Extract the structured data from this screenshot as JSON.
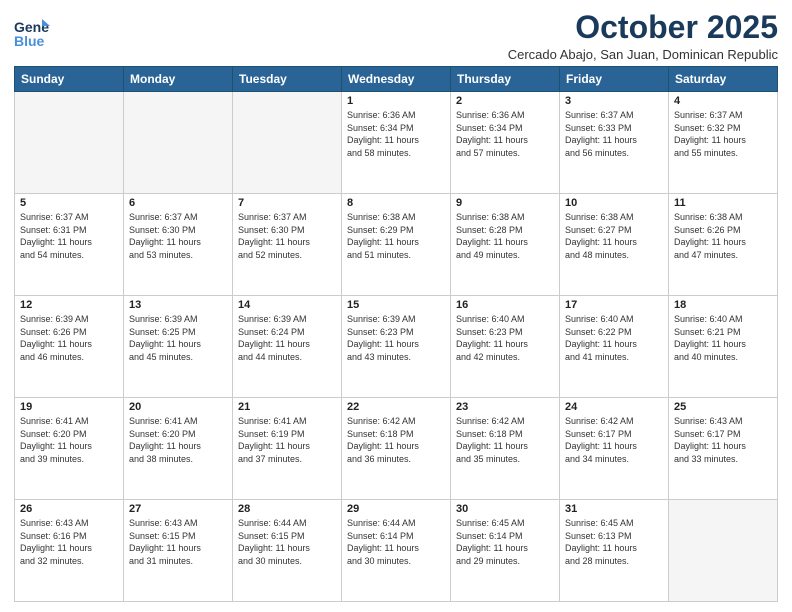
{
  "header": {
    "logo_line1": "General",
    "logo_line2": "Blue",
    "month": "October 2025",
    "location": "Cercado Abajo, San Juan, Dominican Republic"
  },
  "days_of_week": [
    "Sunday",
    "Monday",
    "Tuesday",
    "Wednesday",
    "Thursday",
    "Friday",
    "Saturday"
  ],
  "weeks": [
    [
      {
        "day": "",
        "info": ""
      },
      {
        "day": "",
        "info": ""
      },
      {
        "day": "",
        "info": ""
      },
      {
        "day": "1",
        "info": "Sunrise: 6:36 AM\nSunset: 6:34 PM\nDaylight: 11 hours\nand 58 minutes."
      },
      {
        "day": "2",
        "info": "Sunrise: 6:36 AM\nSunset: 6:34 PM\nDaylight: 11 hours\nand 57 minutes."
      },
      {
        "day": "3",
        "info": "Sunrise: 6:37 AM\nSunset: 6:33 PM\nDaylight: 11 hours\nand 56 minutes."
      },
      {
        "day": "4",
        "info": "Sunrise: 6:37 AM\nSunset: 6:32 PM\nDaylight: 11 hours\nand 55 minutes."
      }
    ],
    [
      {
        "day": "5",
        "info": "Sunrise: 6:37 AM\nSunset: 6:31 PM\nDaylight: 11 hours\nand 54 minutes."
      },
      {
        "day": "6",
        "info": "Sunrise: 6:37 AM\nSunset: 6:30 PM\nDaylight: 11 hours\nand 53 minutes."
      },
      {
        "day": "7",
        "info": "Sunrise: 6:37 AM\nSunset: 6:30 PM\nDaylight: 11 hours\nand 52 minutes."
      },
      {
        "day": "8",
        "info": "Sunrise: 6:38 AM\nSunset: 6:29 PM\nDaylight: 11 hours\nand 51 minutes."
      },
      {
        "day": "9",
        "info": "Sunrise: 6:38 AM\nSunset: 6:28 PM\nDaylight: 11 hours\nand 49 minutes."
      },
      {
        "day": "10",
        "info": "Sunrise: 6:38 AM\nSunset: 6:27 PM\nDaylight: 11 hours\nand 48 minutes."
      },
      {
        "day": "11",
        "info": "Sunrise: 6:38 AM\nSunset: 6:26 PM\nDaylight: 11 hours\nand 47 minutes."
      }
    ],
    [
      {
        "day": "12",
        "info": "Sunrise: 6:39 AM\nSunset: 6:26 PM\nDaylight: 11 hours\nand 46 minutes."
      },
      {
        "day": "13",
        "info": "Sunrise: 6:39 AM\nSunset: 6:25 PM\nDaylight: 11 hours\nand 45 minutes."
      },
      {
        "day": "14",
        "info": "Sunrise: 6:39 AM\nSunset: 6:24 PM\nDaylight: 11 hours\nand 44 minutes."
      },
      {
        "day": "15",
        "info": "Sunrise: 6:39 AM\nSunset: 6:23 PM\nDaylight: 11 hours\nand 43 minutes."
      },
      {
        "day": "16",
        "info": "Sunrise: 6:40 AM\nSunset: 6:23 PM\nDaylight: 11 hours\nand 42 minutes."
      },
      {
        "day": "17",
        "info": "Sunrise: 6:40 AM\nSunset: 6:22 PM\nDaylight: 11 hours\nand 41 minutes."
      },
      {
        "day": "18",
        "info": "Sunrise: 6:40 AM\nSunset: 6:21 PM\nDaylight: 11 hours\nand 40 minutes."
      }
    ],
    [
      {
        "day": "19",
        "info": "Sunrise: 6:41 AM\nSunset: 6:20 PM\nDaylight: 11 hours\nand 39 minutes."
      },
      {
        "day": "20",
        "info": "Sunrise: 6:41 AM\nSunset: 6:20 PM\nDaylight: 11 hours\nand 38 minutes."
      },
      {
        "day": "21",
        "info": "Sunrise: 6:41 AM\nSunset: 6:19 PM\nDaylight: 11 hours\nand 37 minutes."
      },
      {
        "day": "22",
        "info": "Sunrise: 6:42 AM\nSunset: 6:18 PM\nDaylight: 11 hours\nand 36 minutes."
      },
      {
        "day": "23",
        "info": "Sunrise: 6:42 AM\nSunset: 6:18 PM\nDaylight: 11 hours\nand 35 minutes."
      },
      {
        "day": "24",
        "info": "Sunrise: 6:42 AM\nSunset: 6:17 PM\nDaylight: 11 hours\nand 34 minutes."
      },
      {
        "day": "25",
        "info": "Sunrise: 6:43 AM\nSunset: 6:17 PM\nDaylight: 11 hours\nand 33 minutes."
      }
    ],
    [
      {
        "day": "26",
        "info": "Sunrise: 6:43 AM\nSunset: 6:16 PM\nDaylight: 11 hours\nand 32 minutes."
      },
      {
        "day": "27",
        "info": "Sunrise: 6:43 AM\nSunset: 6:15 PM\nDaylight: 11 hours\nand 31 minutes."
      },
      {
        "day": "28",
        "info": "Sunrise: 6:44 AM\nSunset: 6:15 PM\nDaylight: 11 hours\nand 30 minutes."
      },
      {
        "day": "29",
        "info": "Sunrise: 6:44 AM\nSunset: 6:14 PM\nDaylight: 11 hours\nand 30 minutes."
      },
      {
        "day": "30",
        "info": "Sunrise: 6:45 AM\nSunset: 6:14 PM\nDaylight: 11 hours\nand 29 minutes."
      },
      {
        "day": "31",
        "info": "Sunrise: 6:45 AM\nSunset: 6:13 PM\nDaylight: 11 hours\nand 28 minutes."
      },
      {
        "day": "",
        "info": ""
      }
    ]
  ]
}
